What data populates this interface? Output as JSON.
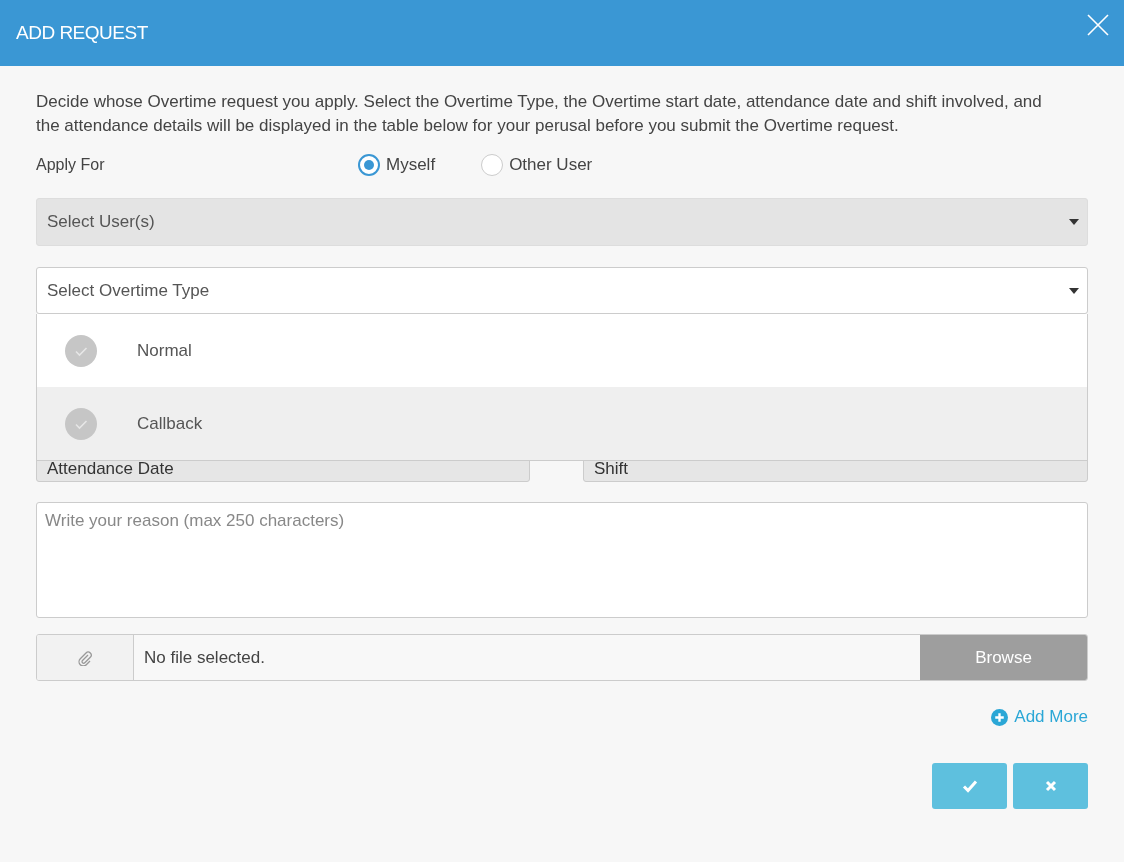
{
  "window": {
    "title": "ADD REQUEST"
  },
  "intro": "Decide whose Overtime request you apply. Select the Overtime Type, the Overtime start date, attendance date and shift involved, and the attendance details will be displayed in the table below for your perusal before you submit the Overtime request.",
  "apply_for": {
    "label": "Apply For",
    "options": [
      {
        "label": "Myself",
        "selected": true
      },
      {
        "label": "Other User",
        "selected": false
      }
    ]
  },
  "user_select": {
    "placeholder": "Select User(s)",
    "disabled": true
  },
  "overtime_type": {
    "placeholder": "Select Overtime Type",
    "expanded": true,
    "options": [
      {
        "label": "Normal",
        "selected": false,
        "highlighted": false
      },
      {
        "label": "Callback",
        "selected": false,
        "highlighted": true
      }
    ]
  },
  "attendance_date": {
    "placeholder": "Attendance Date"
  },
  "shift": {
    "placeholder": "Shift"
  },
  "reason": {
    "placeholder": "Write your reason (max 250 characters)"
  },
  "attachment": {
    "file_name": "No file selected.",
    "button": "Browse"
  },
  "add_more": "Add More"
}
